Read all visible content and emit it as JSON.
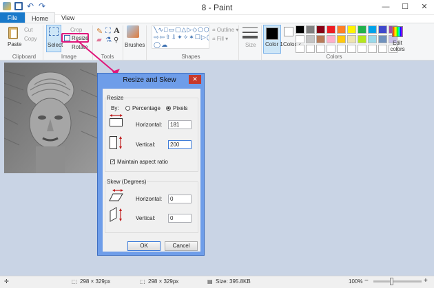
{
  "window": {
    "title": "8 - Paint",
    "minimize": "—",
    "maximize": "☐",
    "close": "✕"
  },
  "tabs": [
    {
      "label": "File"
    },
    {
      "label": "Home"
    },
    {
      "label": "View"
    }
  ],
  "ribbon": {
    "clipboard": {
      "paste": "Paste",
      "cut": "Cut",
      "copy": "Copy",
      "label": "Clipboard"
    },
    "image": {
      "select": "Select",
      "crop": "Crop",
      "resize": "Resize",
      "rotate": "Rotate",
      "label": "Image"
    },
    "tools": {
      "label": "Tools"
    },
    "brushes": {
      "label": "Brushes"
    },
    "shapes": {
      "outline": "Outline",
      "fill": "Fill",
      "label": "Shapes"
    },
    "size": {
      "label": "Size"
    },
    "colors": {
      "color1": "Color 1",
      "color2": "Color 2",
      "edit": "Edit colors",
      "label": "Colors",
      "color1_value": "#000000",
      "color2_value": "#ffffff",
      "palette": [
        "#000000",
        "#7f7f7f",
        "#880015",
        "#ed1c24",
        "#ff7f27",
        "#fff200",
        "#22b14c",
        "#00a2e8",
        "#3f48cc",
        "#a349a4",
        "#ffffff",
        "#c3c3c3",
        "#b97a57",
        "#ffaec9",
        "#ffc90e",
        "#efe4b0",
        "#b5e61d",
        "#99d9ea",
        "#7092be",
        "#c8bfe7",
        "#ffffff",
        "#ffffff",
        "#ffffff",
        "#ffffff",
        "#ffffff",
        "#ffffff",
        "#ffffff",
        "#ffffff",
        "#ffffff",
        "#ffffff"
      ]
    }
  },
  "dialog": {
    "title": "Resize and Skew",
    "close": "✕",
    "resize_section": "Resize",
    "by_label": "By:",
    "percentage": "Percentage",
    "pixels": "Pixels",
    "horizontal_label": "Horizontal:",
    "horizontal_value": "181",
    "vertical_label": "Vertical:",
    "vertical_value": "200",
    "maintain_aspect": "Maintain aspect ratio",
    "skew_section": "Skew (Degrees)",
    "skew_horizontal_label": "Horizontal:",
    "skew_horizontal_value": "0",
    "skew_vertical_label": "Vertical:",
    "skew_vertical_value": "0",
    "ok": "OK",
    "cancel": "Cancel"
  },
  "status": {
    "selection_size": "298 × 329px",
    "image_size": "298 × 329px",
    "file_size": "Size: 395.8KB",
    "zoom": "100%",
    "zoom_out": "−",
    "zoom_in": "+"
  },
  "callout_color": "#e0177a"
}
